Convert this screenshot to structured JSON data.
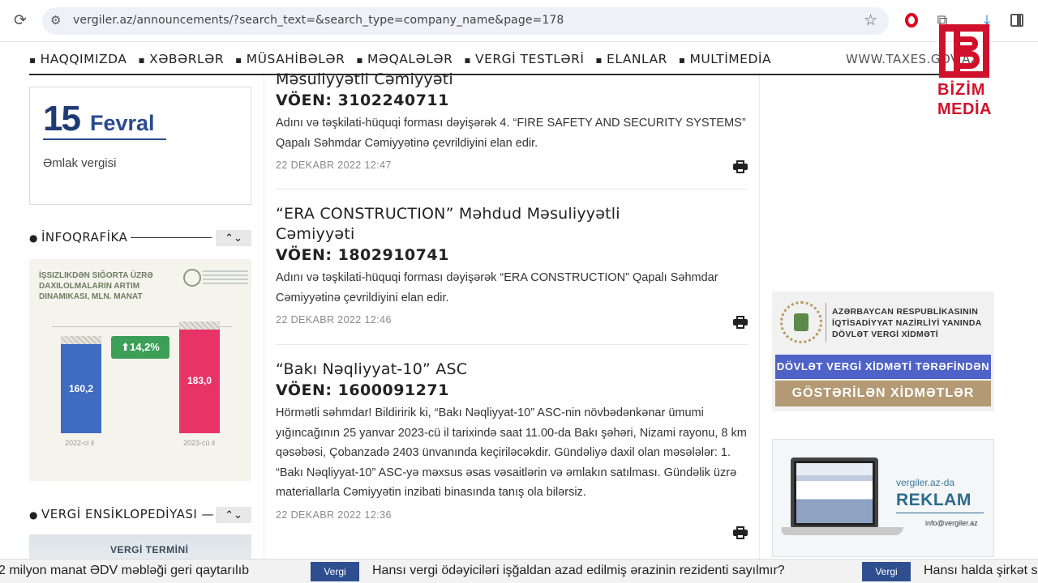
{
  "browser": {
    "url": "vergiler.az/announcements/?search_text=&search_type=company_name&page=178"
  },
  "nav": {
    "items": [
      "HAQQIMIZDA",
      "XƏBƏRLƏR",
      "MÜSAHİBƏLƏR",
      "MƏQALƏLƏR",
      "VERGİ TESTLƏRİ",
      "ELANLAR",
      "MULTİMEDİA"
    ],
    "site_link": "WWW.TAXES.GOV.AZ"
  },
  "logo": {
    "line1": "BİZİM",
    "line2": "MEDİA"
  },
  "sidebar": {
    "calendar": {
      "day": "15",
      "month": "Fevral",
      "subject": "Əmlak vergisi"
    },
    "infographic_header": "İNFOQRAFİKA",
    "infographic": {
      "title": "İşsizlikdən sığorta üzrə daxilolmaların artım dinamikası, mln. manat",
      "change_badge": "⬆14,2%",
      "bars": [
        {
          "year": "2022-ci il",
          "value": "160,2"
        },
        {
          "year": "2023-cü il",
          "value": "183,0"
        }
      ]
    },
    "encyclopedia_header": "VERGİ ENSİKLOPEDİYASI",
    "encyclopedia_card_title": "VERGİ TERMİNİ",
    "arrows": "⌃⌄"
  },
  "announcements": [
    {
      "company": "Məsuliyyətli Cəmiyyəti",
      "voen": "VÖEN: 3102240711",
      "description": "Adını və təşkilati-hüquqi forması dəyişərək 4. “FIRE SAFETY AND SECURITY SYSTEMS” Qapalı Səhmdar Cəmiyyətinə çevrildiyini elan edir.",
      "date": "22 DEKABR 2022 12:47"
    },
    {
      "company": "“ERA CONSTRUCTION” Məhdud Məsuliyyətli Cəmiyyəti",
      "voen": "VÖEN: 1802910741",
      "description": "Adını və təşkilati-hüquqi forması dəyişərək “ERA CONSTRUCTION” Qapalı Səhmdar Cəmiyyətinə çevrildiyini elan edir.",
      "date": "22 DEKABR 2022 12:46"
    },
    {
      "company": "“Bakı Nəqliyyat-10” ASC",
      "voen": "VÖEN: 1600091271",
      "description": "Hörmətli səhmdar! Bildiririk ki, “Bakı Nəqliyyat-10” ASC-nin növbədənkənar ümumi yığıncağının 25 yanvar 2023-cü il tarixində saat 11.00-da Bakı şəhəri, Nizami rayonu, 8 km qəsəbəsi, Çobanzadə 2403 ünvanında keçiriləcəkdir. Gündəliyə daxil olan məsələlər: 1. “Bakı Nəqliyyat-10” ASC-yə məxsus əsas vəsaitlərin və əmlakın satılması. Gündəlik üzrə materiallarla Cəmiyyətin inzibati binasında tanış ola bilərsiz.",
      "date": "22 DEKABR 2022 12:36"
    }
  ],
  "ads": {
    "ad1": {
      "org": "AZƏRBAYCAN RESPUBLİKASININ İQTİSADİYYAT NAZİRLİYİ YANINDA DÖVLƏT VERGİ XİDMƏTİ",
      "band1": "DÖVLƏT VERGİ XİDMƏTİ TƏRƏFİNDƏN",
      "band2": "GÖSTƏRİLƏN XİDMƏTLƏR"
    },
    "ad2": {
      "site": "vergiler.az-da",
      "headline": "REKLAM",
      "email": "info@vergiler.az"
    }
  },
  "ticker": {
    "items": [
      {
        "text": "2 milyon manat ƏDV məbləği geri qaytarılıb"
      },
      {
        "tag": "Vergi",
        "text": "Hansı vergi ödəyiciləri işğaldan azad edilmiş ərazinin rezidenti sayılmır?"
      },
      {
        "tag": "Vergi",
        "text": "Hansı halda şirkət s"
      }
    ]
  },
  "colors": {
    "brand_red": "#d1112b",
    "navy": "#1f3b73",
    "ticker_tag": "#2e4e8f"
  }
}
